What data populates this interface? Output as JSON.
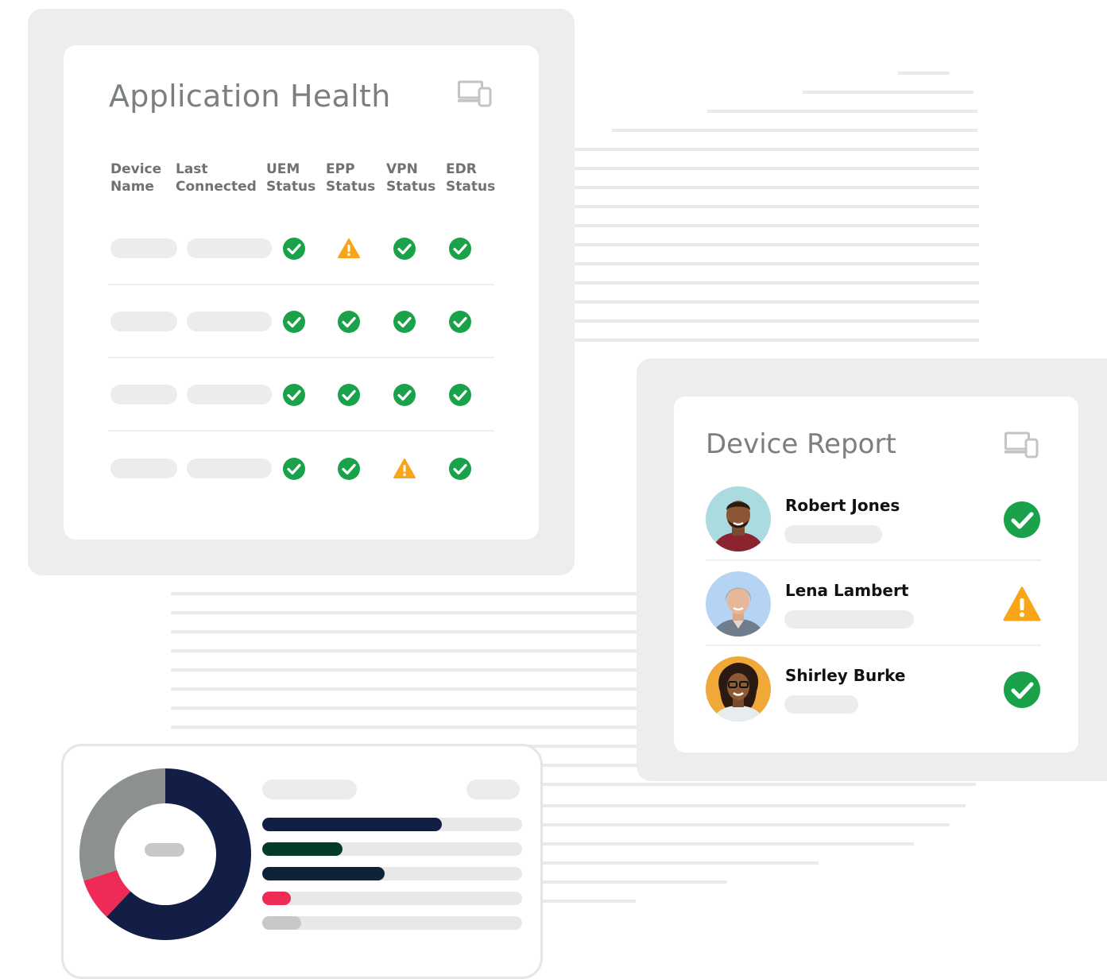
{
  "application_health": {
    "title": "Application Health",
    "columns": [
      {
        "line1": "Device",
        "line2": "Name"
      },
      {
        "line1": "Last",
        "line2": "Connected"
      },
      {
        "line1": "UEM",
        "line2": "Status"
      },
      {
        "line1": "EPP",
        "line2": "Status"
      },
      {
        "line1": "VPN",
        "line2": "Status"
      },
      {
        "line1": "EDR",
        "line2": "Status"
      }
    ],
    "rows": [
      {
        "uem": "ok",
        "epp": "warning",
        "vpn": "ok",
        "edr": "ok"
      },
      {
        "uem": "ok",
        "epp": "ok",
        "vpn": "ok",
        "edr": "ok"
      },
      {
        "uem": "ok",
        "epp": "ok",
        "vpn": "ok",
        "edr": "ok"
      },
      {
        "uem": "ok",
        "epp": "ok",
        "vpn": "warning",
        "edr": "ok"
      }
    ]
  },
  "device_report": {
    "title": "Device Report",
    "people": [
      {
        "name": "Robert Jones",
        "status": "ok",
        "avatar_bg": "#a9dbe0"
      },
      {
        "name": "Lena Lambert",
        "status": "warning",
        "avatar_bg": "#b5d3f2"
      },
      {
        "name": "Shirley Burke",
        "status": "ok",
        "avatar_bg": "#f0a938"
      }
    ]
  },
  "summary_chart": {
    "donut_shares": [
      {
        "color": "#121e45",
        "share": 0.62
      },
      {
        "color": "#ee2a56",
        "share": 0.08
      },
      {
        "color": "#8c918f",
        "share": 0.3
      }
    ],
    "bars": [
      {
        "color": "#121e45",
        "fraction": 0.69
      },
      {
        "color": "#063b2b",
        "fraction": 0.31
      },
      {
        "color": "#0e2239",
        "fraction": 0.47
      },
      {
        "color": "#ee2a56",
        "fraction": 0.11
      },
      {
        "color": "#c6c9c8",
        "fraction": 0.15
      }
    ]
  },
  "colors": {
    "ok": "#19a24a",
    "warning": "#f9a51a",
    "panel_bg": "#eceded",
    "stripe": "#e9eaea"
  },
  "icons": {
    "panel_corner": "devices-icon",
    "ok": "check-circle-icon",
    "warning": "warning-triangle-icon"
  }
}
